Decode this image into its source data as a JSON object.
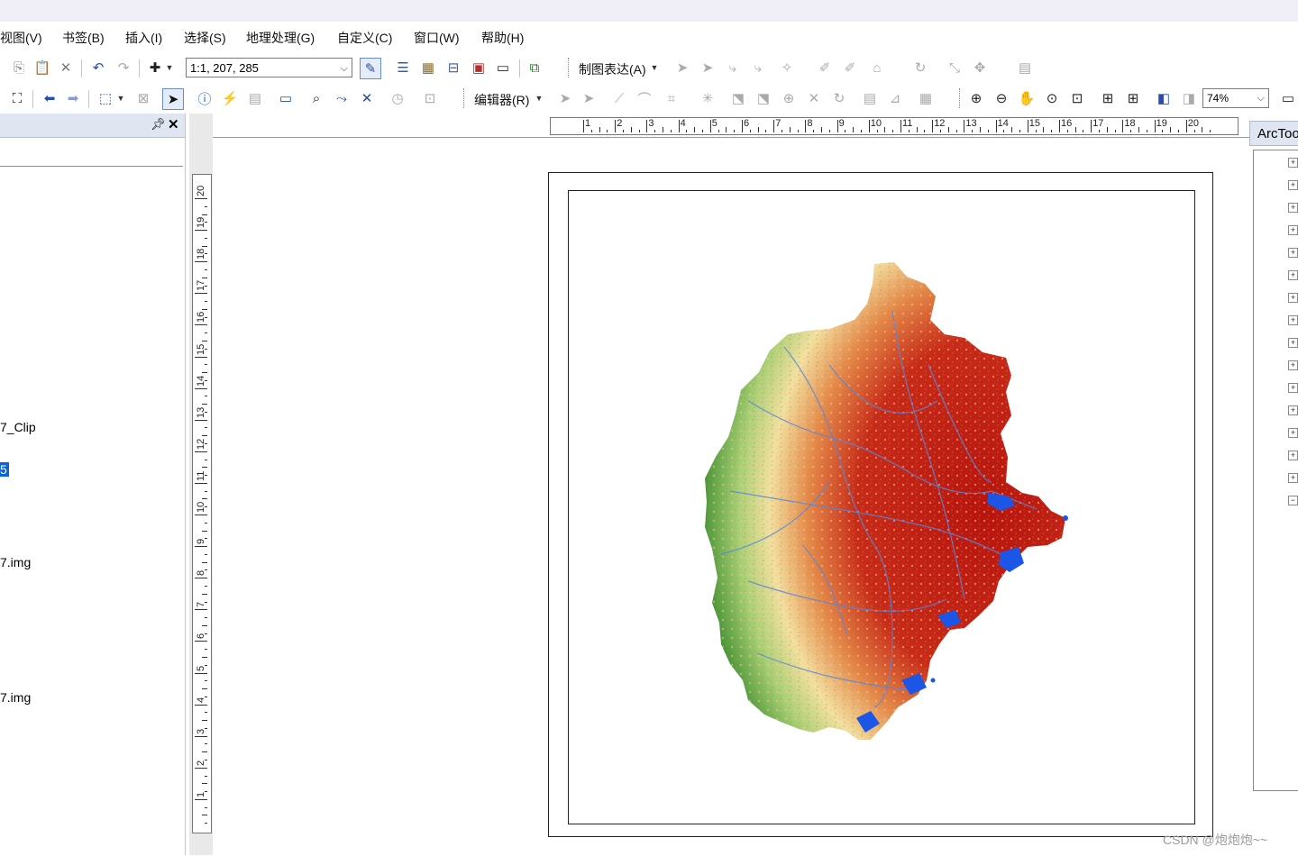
{
  "menu": {
    "items": [
      "视图(V)",
      "书签(B)",
      "插入(I)",
      "选择(S)",
      "地理处理(G)",
      "自定义(C)",
      "窗口(W)",
      "帮助(H)"
    ]
  },
  "toolbar1": {
    "scale_value": "1:1, 207, 285",
    "representation_label": "制图表达(A)"
  },
  "toolbar2": {
    "editor_label": "编辑器(R)",
    "zoom_value": "74%"
  },
  "toc": {
    "items": [
      "7_Clip",
      "5",
      "7.img",
      "7.img"
    ]
  },
  "ruler": {
    "horizontal": [
      "1",
      "2",
      "3",
      "4",
      "5",
      "6",
      "7",
      "8",
      "9",
      "10",
      "11",
      "12",
      "13",
      "14",
      "15",
      "16",
      "17",
      "18",
      "19",
      "20"
    ],
    "vertical": [
      "20",
      "19",
      "18",
      "17",
      "16",
      "15",
      "14",
      "13",
      "12",
      "11",
      "10",
      "9",
      "8",
      "7",
      "6",
      "5",
      "4",
      "3",
      "2",
      "1"
    ]
  },
  "arctoolbox": {
    "title": "ArcToo"
  },
  "watermark": "CSDN @炮炮炮~~",
  "colors": {
    "dem_low": "#c0241c",
    "dem_mid": "#f5e7a4",
    "dem_high": "#2f8a2a",
    "rivers": "#4a78d8",
    "water": "#1b56e6",
    "selection": "#0a64d8"
  }
}
